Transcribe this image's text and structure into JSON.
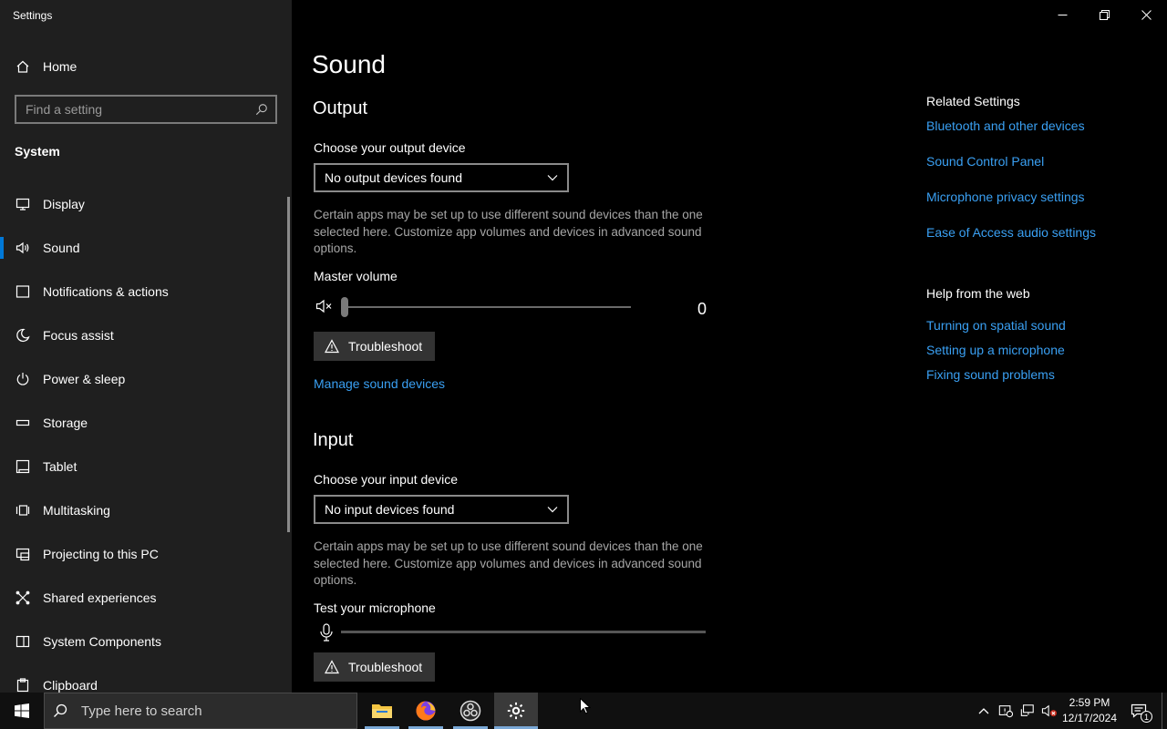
{
  "window": {
    "title": "Settings"
  },
  "sidebar": {
    "home_label": "Home",
    "search_placeholder": "Find a setting",
    "section": "System",
    "items": [
      {
        "label": "Display",
        "icon": "monitor-icon"
      },
      {
        "label": "Sound",
        "icon": "speaker-icon",
        "active": true
      },
      {
        "label": "Notifications & actions",
        "icon": "notification-icon"
      },
      {
        "label": "Focus assist",
        "icon": "moon-icon"
      },
      {
        "label": "Power & sleep",
        "icon": "power-icon"
      },
      {
        "label": "Storage",
        "icon": "storage-icon"
      },
      {
        "label": "Tablet",
        "icon": "tablet-icon"
      },
      {
        "label": "Multitasking",
        "icon": "multitasking-icon"
      },
      {
        "label": "Projecting to this PC",
        "icon": "projector-icon"
      },
      {
        "label": "Shared experiences",
        "icon": "shared-icon"
      },
      {
        "label": "System Components",
        "icon": "components-icon"
      },
      {
        "label": "Clipboard",
        "icon": "clipboard-icon"
      }
    ]
  },
  "main": {
    "title": "Sound",
    "output": {
      "heading": "Output",
      "device_label": "Choose your output device",
      "device_value": "No output devices found",
      "note": "Certain apps may be set up to use different sound devices than the one selected here. Customize app volumes and devices in advanced sound options.",
      "volume_label": "Master volume",
      "volume_value": "0",
      "volume_level": 0,
      "troubleshoot_label": "Troubleshoot",
      "manage_link": "Manage sound devices"
    },
    "input": {
      "heading": "Input",
      "device_label": "Choose your input device",
      "device_value": "No input devices found",
      "note": "Certain apps may be set up to use different sound devices than the one selected here. Customize app volumes and devices in advanced sound options.",
      "mic_label": "Test your microphone",
      "troubleshoot_label": "Troubleshoot"
    }
  },
  "related": {
    "heading": "Related Settings",
    "links": [
      "Bluetooth and other devices",
      "Sound Control Panel",
      "Microphone privacy settings",
      "Ease of Access audio settings"
    ]
  },
  "help": {
    "heading": "Help from the web",
    "links": [
      "Turning on spatial sound",
      "Setting up a microphone",
      "Fixing sound problems"
    ]
  },
  "taskbar": {
    "search_placeholder": "Type here to search",
    "time": "2:59 PM",
    "date": "12/17/2024",
    "notification_count": "1"
  },
  "colors": {
    "accent": "#0078d7",
    "link": "#3aa0f3",
    "sidebar_bg": "#1f1f1f",
    "main_bg": "#000000"
  }
}
